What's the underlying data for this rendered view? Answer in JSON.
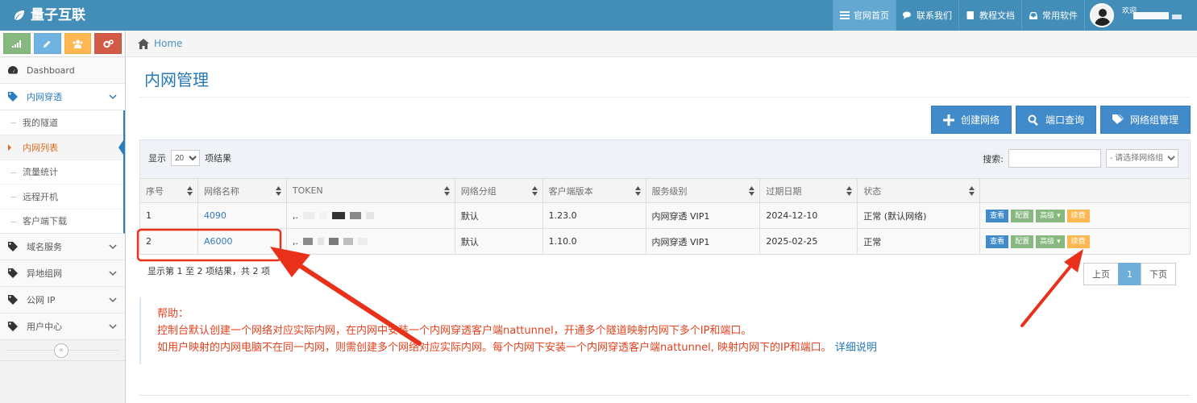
{
  "navbar": {
    "brand": "量子互联",
    "links": [
      {
        "label": "官网首页",
        "icon": "list-icon"
      },
      {
        "label": "联系我们",
        "icon": "comments-icon"
      },
      {
        "label": "教程文档",
        "icon": "book-icon"
      },
      {
        "label": "常用软件",
        "icon": "inbox-icon"
      }
    ],
    "welcome": "欢迎"
  },
  "sidebar": {
    "dashboard": "Dashboard",
    "groups": [
      {
        "label": "内网穿透",
        "open": true
      },
      {
        "label": "域名服务"
      },
      {
        "label": "异地组网"
      },
      {
        "label": "公网 IP"
      },
      {
        "label": "用户中心"
      }
    ],
    "sub_items": [
      "我的隧道",
      "内网列表",
      "流量统计",
      "远程开机",
      "客户端下载"
    ],
    "active_sub": "内网列表"
  },
  "breadcrumb": {
    "home": "Home"
  },
  "page": {
    "title": "内网管理"
  },
  "actions": {
    "create": "创建网络",
    "port_query": "端口查询",
    "group_manage": "网络组管理"
  },
  "table_controls": {
    "show_prefix": "显示",
    "page_size": "20",
    "show_suffix": "项结果",
    "search_label": "搜索:",
    "search_value": "",
    "group_placeholder": "- 请选择网络组"
  },
  "table": {
    "headers": [
      "序号",
      "网络名称",
      "TOKEN",
      "网络分组",
      "客户端版本",
      "服务级别",
      "过期日期",
      "状态",
      ""
    ],
    "rows": [
      {
        "no": "1",
        "name": "4090",
        "group": "默认",
        "version": "1.23.0",
        "level": "内网穿透 VIP1",
        "expire": "2024-12-10",
        "status": "正常 (默认网络)"
      },
      {
        "no": "2",
        "name": "A6000",
        "group": "默认",
        "version": "1.10.0",
        "level": "内网穿透 VIP1",
        "expire": "2025-02-25",
        "status": "正常"
      }
    ],
    "ops": {
      "view": "查看",
      "config": "配置",
      "advanced": "高级",
      "renew": "续费"
    }
  },
  "table_info": "显示第 1 至 2 项结果，共 2 项",
  "pager": {
    "prev": "上页",
    "current": "1",
    "next": "下页"
  },
  "help": {
    "title": "帮助：",
    "line1": "控制台默认创建一个网络对应实际内网，在内网中安装一个内网穿透客户端nattunnel，开通多个隧道映射内网下多个IP和端口。",
    "line2": "如用户映射的内网电脑不在同一内网，则需创建多个网络对应实际内网。每个内网下安装一个内网穿透客户端nattunnel, 映射内网下的IP和端口。",
    "link": "详细说明"
  },
  "colors": {
    "navbar": "#438eb9",
    "accent": "#2679b5",
    "annotation": "#e8301b"
  }
}
